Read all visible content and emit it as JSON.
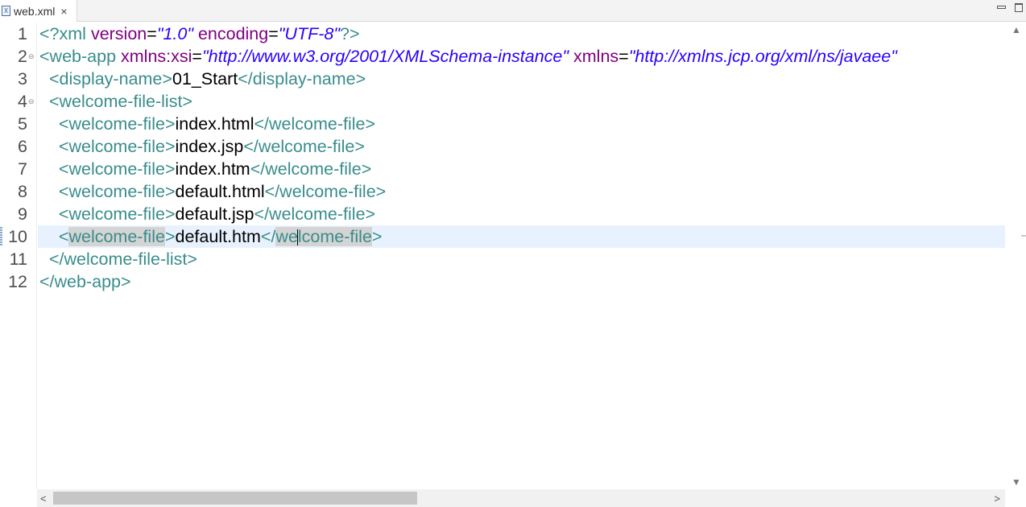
{
  "tab": {
    "title": "web.xml",
    "icon": "xml-file-icon",
    "icon_glyph": "X",
    "close": "×"
  },
  "editor": {
    "current_line": 10,
    "lines": [
      {
        "num": "1"
      },
      {
        "num": "2",
        "fold": "⊖"
      },
      {
        "num": "3"
      },
      {
        "num": "4",
        "fold": "⊖"
      },
      {
        "num": "5"
      },
      {
        "num": "6"
      },
      {
        "num": "7"
      },
      {
        "num": "8"
      },
      {
        "num": "9"
      },
      {
        "num": "10"
      },
      {
        "num": "11"
      },
      {
        "num": "12"
      }
    ],
    "code": {
      "l1": {
        "pi_open": "<?xml",
        "attr1": "version",
        "eq": "=",
        "val1": "\"1.0\"",
        "attr2": "encoding",
        "val2": "\"UTF-8\"",
        "pi_close": "?>"
      },
      "l2": {
        "open": "<web-app",
        "attr1": "xmlns:xsi",
        "eq": "=",
        "val1": "\"http://www.w3.org/2001/XMLSchema-instance\"",
        "attr2": "xmlns",
        "val2": "\"http://xmlns.jcp.org/xml/ns/javaee\""
      },
      "l3": {
        "indent": "  ",
        "open": "<display-name>",
        "text": "01_Start",
        "close": "</display-name>"
      },
      "l4": {
        "indent": "  ",
        "open": "<welcome-file-list>"
      },
      "l5": {
        "indent": "    ",
        "open": "<welcome-file>",
        "text": "index.html",
        "close": "</welcome-file>"
      },
      "l6": {
        "indent": "    ",
        "open": "<welcome-file>",
        "text": "index.jsp",
        "close": "</welcome-file>"
      },
      "l7": {
        "indent": "    ",
        "open": "<welcome-file>",
        "text": "index.htm",
        "close": "</welcome-file>"
      },
      "l8": {
        "indent": "    ",
        "open": "<welcome-file>",
        "text": "default.html",
        "close": "</welcome-file>"
      },
      "l9": {
        "indent": "    ",
        "open": "<welcome-file>",
        "text": "default.jsp",
        "close": "</welcome-file>"
      },
      "l10": {
        "indent": "    ",
        "lt": "<",
        "tag_hl": "welcome-file",
        "gt": ">",
        "text": "default.htm",
        "close_lt": "</",
        "tag_hl2a": "we",
        "tag_hl2b": "lcome-file",
        "gt2": ">"
      },
      "l11": {
        "indent": "  ",
        "close": "</welcome-file-list>"
      },
      "l12": {
        "close": "</web-app>"
      }
    }
  },
  "scrollbars": {
    "vertical": {
      "up": "▲",
      "down": "▼"
    },
    "horizontal": {
      "left": "<",
      "right": ">",
      "thumb_fraction": 0.38
    }
  }
}
